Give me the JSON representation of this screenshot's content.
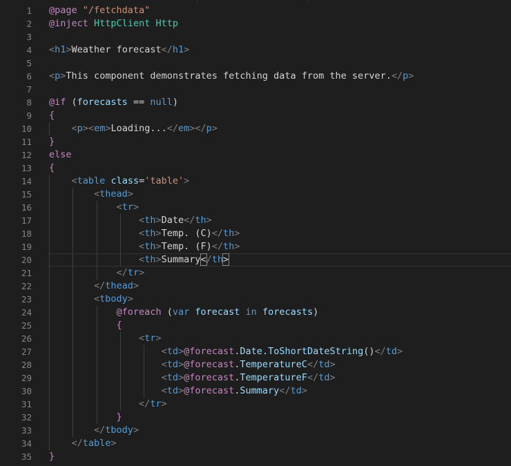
{
  "editor": {
    "current_line": 20,
    "lines": [
      {
        "n": "1",
        "tokens": [
          [
            "@page",
            "razor"
          ],
          [
            " ",
            "text"
          ],
          [
            "\"/fetchdata\"",
            "str"
          ]
        ]
      },
      {
        "n": "2",
        "tokens": [
          [
            "@inject",
            "razor"
          ],
          [
            " ",
            "text"
          ],
          [
            "HttpClient",
            "type"
          ],
          [
            " ",
            "text"
          ],
          [
            "Http",
            "type"
          ]
        ]
      },
      {
        "n": "3",
        "tokens": []
      },
      {
        "n": "4",
        "tokens": [
          [
            "<",
            "punct"
          ],
          [
            "h1",
            "tag"
          ],
          [
            ">",
            "punct"
          ],
          [
            "Weather forecast",
            "text"
          ],
          [
            "</",
            "punct"
          ],
          [
            "h1",
            "tag"
          ],
          [
            ">",
            "punct"
          ]
        ]
      },
      {
        "n": "5",
        "tokens": []
      },
      {
        "n": "6",
        "tokens": [
          [
            "<",
            "punct"
          ],
          [
            "p",
            "tag"
          ],
          [
            ">",
            "punct"
          ],
          [
            "This component demonstrates fetching data from the server.",
            "text"
          ],
          [
            "</",
            "punct"
          ],
          [
            "p",
            "tag"
          ],
          [
            ">",
            "punct"
          ]
        ]
      },
      {
        "n": "7",
        "tokens": []
      },
      {
        "n": "8",
        "tokens": [
          [
            "@if",
            "razor"
          ],
          [
            " (",
            "text"
          ],
          [
            "forecasts",
            "var"
          ],
          [
            " == ",
            "text"
          ],
          [
            "null",
            "kw"
          ],
          [
            ")",
            "text"
          ]
        ]
      },
      {
        "n": "9",
        "tokens": [
          [
            "{",
            "razor"
          ]
        ]
      },
      {
        "n": "10",
        "indent": 1,
        "tokens": [
          [
            "    ",
            "text"
          ],
          [
            "<",
            "punct"
          ],
          [
            "p",
            "tag"
          ],
          [
            "><",
            "punct"
          ],
          [
            "em",
            "tag"
          ],
          [
            ">",
            "punct"
          ],
          [
            "Loading...",
            "text"
          ],
          [
            "</",
            "punct"
          ],
          [
            "em",
            "tag"
          ],
          [
            "></",
            "punct"
          ],
          [
            "p",
            "tag"
          ],
          [
            ">",
            "punct"
          ]
        ]
      },
      {
        "n": "11",
        "tokens": [
          [
            "}",
            "razor"
          ]
        ]
      },
      {
        "n": "12",
        "tokens": [
          [
            "else",
            "razor"
          ]
        ]
      },
      {
        "n": "13",
        "tokens": [
          [
            "{",
            "razor"
          ]
        ]
      },
      {
        "n": "14",
        "indent": 1,
        "tokens": [
          [
            "    ",
            "text"
          ],
          [
            "<",
            "punct"
          ],
          [
            "table",
            "tag"
          ],
          [
            " ",
            "text"
          ],
          [
            "class",
            "attr"
          ],
          [
            "=",
            "text"
          ],
          [
            "'table'",
            "str"
          ],
          [
            ">",
            "punct"
          ]
        ]
      },
      {
        "n": "15",
        "indent": 2,
        "tokens": [
          [
            "        ",
            "text"
          ],
          [
            "<",
            "punct"
          ],
          [
            "thead",
            "tag"
          ],
          [
            ">",
            "punct"
          ]
        ]
      },
      {
        "n": "16",
        "indent": 3,
        "tokens": [
          [
            "            ",
            "text"
          ],
          [
            "<",
            "punct"
          ],
          [
            "tr",
            "tag"
          ],
          [
            ">",
            "punct"
          ]
        ]
      },
      {
        "n": "17",
        "indent": 4,
        "tokens": [
          [
            "                ",
            "text"
          ],
          [
            "<",
            "punct"
          ],
          [
            "th",
            "tag"
          ],
          [
            ">",
            "punct"
          ],
          [
            "Date",
            "text"
          ],
          [
            "</",
            "punct"
          ],
          [
            "th",
            "tag"
          ],
          [
            ">",
            "punct"
          ]
        ]
      },
      {
        "n": "18",
        "indent": 4,
        "tokens": [
          [
            "                ",
            "text"
          ],
          [
            "<",
            "punct"
          ],
          [
            "th",
            "tag"
          ],
          [
            ">",
            "punct"
          ],
          [
            "Temp. (C)",
            "text"
          ],
          [
            "</",
            "punct"
          ],
          [
            "th",
            "tag"
          ],
          [
            ">",
            "punct"
          ]
        ]
      },
      {
        "n": "19",
        "indent": 4,
        "tokens": [
          [
            "                ",
            "text"
          ],
          [
            "<",
            "punct"
          ],
          [
            "th",
            "tag"
          ],
          [
            ">",
            "punct"
          ],
          [
            "Temp. (F)",
            "text"
          ],
          [
            "</",
            "punct"
          ],
          [
            "th",
            "tag"
          ],
          [
            ">",
            "punct"
          ]
        ]
      },
      {
        "n": "20",
        "indent": 4,
        "tokens": [
          [
            "                ",
            "text"
          ],
          [
            "<",
            "punct"
          ],
          [
            "th",
            "tag"
          ],
          [
            ">",
            "punct"
          ],
          [
            "Summary",
            "text"
          ],
          [
            "<",
            "hl"
          ],
          [
            "/",
            "punct"
          ],
          [
            "th",
            "tag"
          ],
          [
            ">",
            "hl"
          ]
        ]
      },
      {
        "n": "21",
        "indent": 3,
        "tokens": [
          [
            "            ",
            "text"
          ],
          [
            "</",
            "punct"
          ],
          [
            "tr",
            "tag"
          ],
          [
            ">",
            "punct"
          ]
        ]
      },
      {
        "n": "22",
        "indent": 2,
        "tokens": [
          [
            "        ",
            "text"
          ],
          [
            "</",
            "punct"
          ],
          [
            "thead",
            "tag"
          ],
          [
            ">",
            "punct"
          ]
        ]
      },
      {
        "n": "23",
        "indent": 2,
        "tokens": [
          [
            "        ",
            "text"
          ],
          [
            "<",
            "punct"
          ],
          [
            "tbody",
            "tag"
          ],
          [
            ">",
            "punct"
          ]
        ]
      },
      {
        "n": "24",
        "indent": 3,
        "tokens": [
          [
            "            ",
            "text"
          ],
          [
            "@foreach",
            "razor"
          ],
          [
            " (",
            "text"
          ],
          [
            "var",
            "kw"
          ],
          [
            " ",
            "text"
          ],
          [
            "forecast",
            "var"
          ],
          [
            " ",
            "text"
          ],
          [
            "in",
            "kw"
          ],
          [
            " ",
            "text"
          ],
          [
            "forecasts",
            "var"
          ],
          [
            ")",
            "text"
          ]
        ]
      },
      {
        "n": "25",
        "indent": 3,
        "tokens": [
          [
            "            ",
            "text"
          ],
          [
            "{",
            "razor"
          ]
        ]
      },
      {
        "n": "26",
        "indent": 4,
        "tokens": [
          [
            "                ",
            "text"
          ],
          [
            "<",
            "punct"
          ],
          [
            "tr",
            "tag"
          ],
          [
            ">",
            "punct"
          ]
        ]
      },
      {
        "n": "27",
        "indent": 5,
        "tokens": [
          [
            "                    ",
            "text"
          ],
          [
            "<",
            "punct"
          ],
          [
            "td",
            "tag"
          ],
          [
            ">",
            "punct"
          ],
          [
            "@forecast",
            "razor"
          ],
          [
            ".",
            "text"
          ],
          [
            "Date",
            "var"
          ],
          [
            ".",
            "text"
          ],
          [
            "ToShortDateString",
            "var"
          ],
          [
            "()",
            "text"
          ],
          [
            "</",
            "punct"
          ],
          [
            "td",
            "tag"
          ],
          [
            ">",
            "punct"
          ]
        ]
      },
      {
        "n": "28",
        "indent": 5,
        "tokens": [
          [
            "                    ",
            "text"
          ],
          [
            "<",
            "punct"
          ],
          [
            "td",
            "tag"
          ],
          [
            ">",
            "punct"
          ],
          [
            "@forecast",
            "razor"
          ],
          [
            ".",
            "text"
          ],
          [
            "TemperatureC",
            "var"
          ],
          [
            "</",
            "punct"
          ],
          [
            "td",
            "tag"
          ],
          [
            ">",
            "punct"
          ]
        ]
      },
      {
        "n": "29",
        "indent": 5,
        "tokens": [
          [
            "                    ",
            "text"
          ],
          [
            "<",
            "punct"
          ],
          [
            "td",
            "tag"
          ],
          [
            ">",
            "punct"
          ],
          [
            "@forecast",
            "razor"
          ],
          [
            ".",
            "text"
          ],
          [
            "TemperatureF",
            "var"
          ],
          [
            "</",
            "punct"
          ],
          [
            "td",
            "tag"
          ],
          [
            ">",
            "punct"
          ]
        ]
      },
      {
        "n": "30",
        "indent": 5,
        "tokens": [
          [
            "                    ",
            "text"
          ],
          [
            "<",
            "punct"
          ],
          [
            "td",
            "tag"
          ],
          [
            ">",
            "punct"
          ],
          [
            "@forecast",
            "razor"
          ],
          [
            ".",
            "text"
          ],
          [
            "Summary",
            "var"
          ],
          [
            "</",
            "punct"
          ],
          [
            "td",
            "tag"
          ],
          [
            ">",
            "punct"
          ]
        ]
      },
      {
        "n": "31",
        "indent": 4,
        "tokens": [
          [
            "                ",
            "text"
          ],
          [
            "</",
            "punct"
          ],
          [
            "tr",
            "tag"
          ],
          [
            ">",
            "punct"
          ]
        ]
      },
      {
        "n": "32",
        "indent": 3,
        "tokens": [
          [
            "            ",
            "text"
          ],
          [
            "}",
            "razor"
          ]
        ]
      },
      {
        "n": "33",
        "indent": 2,
        "tokens": [
          [
            "        ",
            "text"
          ],
          [
            "</",
            "punct"
          ],
          [
            "tbody",
            "tag"
          ],
          [
            ">",
            "punct"
          ]
        ]
      },
      {
        "n": "34",
        "indent": 1,
        "tokens": [
          [
            "    ",
            "text"
          ],
          [
            "</",
            "punct"
          ],
          [
            "table",
            "tag"
          ],
          [
            ">",
            "punct"
          ]
        ]
      },
      {
        "n": "35",
        "tokens": [
          [
            "}",
            "razor"
          ]
        ]
      }
    ]
  }
}
